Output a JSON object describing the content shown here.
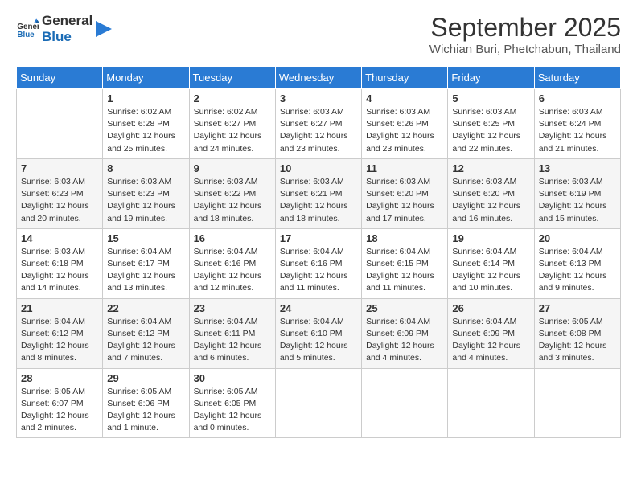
{
  "header": {
    "logo_line1": "General",
    "logo_line2": "Blue",
    "month": "September 2025",
    "location": "Wichian Buri, Phetchabun, Thailand"
  },
  "weekdays": [
    "Sunday",
    "Monday",
    "Tuesday",
    "Wednesday",
    "Thursday",
    "Friday",
    "Saturday"
  ],
  "weeks": [
    [
      {
        "day": "",
        "info": ""
      },
      {
        "day": "1",
        "info": "Sunrise: 6:02 AM\nSunset: 6:28 PM\nDaylight: 12 hours\nand 25 minutes."
      },
      {
        "day": "2",
        "info": "Sunrise: 6:02 AM\nSunset: 6:27 PM\nDaylight: 12 hours\nand 24 minutes."
      },
      {
        "day": "3",
        "info": "Sunrise: 6:03 AM\nSunset: 6:27 PM\nDaylight: 12 hours\nand 23 minutes."
      },
      {
        "day": "4",
        "info": "Sunrise: 6:03 AM\nSunset: 6:26 PM\nDaylight: 12 hours\nand 23 minutes."
      },
      {
        "day": "5",
        "info": "Sunrise: 6:03 AM\nSunset: 6:25 PM\nDaylight: 12 hours\nand 22 minutes."
      },
      {
        "day": "6",
        "info": "Sunrise: 6:03 AM\nSunset: 6:24 PM\nDaylight: 12 hours\nand 21 minutes."
      }
    ],
    [
      {
        "day": "7",
        "info": "Sunrise: 6:03 AM\nSunset: 6:23 PM\nDaylight: 12 hours\nand 20 minutes."
      },
      {
        "day": "8",
        "info": "Sunrise: 6:03 AM\nSunset: 6:23 PM\nDaylight: 12 hours\nand 19 minutes."
      },
      {
        "day": "9",
        "info": "Sunrise: 6:03 AM\nSunset: 6:22 PM\nDaylight: 12 hours\nand 18 minutes."
      },
      {
        "day": "10",
        "info": "Sunrise: 6:03 AM\nSunset: 6:21 PM\nDaylight: 12 hours\nand 18 minutes."
      },
      {
        "day": "11",
        "info": "Sunrise: 6:03 AM\nSunset: 6:20 PM\nDaylight: 12 hours\nand 17 minutes."
      },
      {
        "day": "12",
        "info": "Sunrise: 6:03 AM\nSunset: 6:20 PM\nDaylight: 12 hours\nand 16 minutes."
      },
      {
        "day": "13",
        "info": "Sunrise: 6:03 AM\nSunset: 6:19 PM\nDaylight: 12 hours\nand 15 minutes."
      }
    ],
    [
      {
        "day": "14",
        "info": "Sunrise: 6:03 AM\nSunset: 6:18 PM\nDaylight: 12 hours\nand 14 minutes."
      },
      {
        "day": "15",
        "info": "Sunrise: 6:04 AM\nSunset: 6:17 PM\nDaylight: 12 hours\nand 13 minutes."
      },
      {
        "day": "16",
        "info": "Sunrise: 6:04 AM\nSunset: 6:16 PM\nDaylight: 12 hours\nand 12 minutes."
      },
      {
        "day": "17",
        "info": "Sunrise: 6:04 AM\nSunset: 6:16 PM\nDaylight: 12 hours\nand 11 minutes."
      },
      {
        "day": "18",
        "info": "Sunrise: 6:04 AM\nSunset: 6:15 PM\nDaylight: 12 hours\nand 11 minutes."
      },
      {
        "day": "19",
        "info": "Sunrise: 6:04 AM\nSunset: 6:14 PM\nDaylight: 12 hours\nand 10 minutes."
      },
      {
        "day": "20",
        "info": "Sunrise: 6:04 AM\nSunset: 6:13 PM\nDaylight: 12 hours\nand 9 minutes."
      }
    ],
    [
      {
        "day": "21",
        "info": "Sunrise: 6:04 AM\nSunset: 6:12 PM\nDaylight: 12 hours\nand 8 minutes."
      },
      {
        "day": "22",
        "info": "Sunrise: 6:04 AM\nSunset: 6:12 PM\nDaylight: 12 hours\nand 7 minutes."
      },
      {
        "day": "23",
        "info": "Sunrise: 6:04 AM\nSunset: 6:11 PM\nDaylight: 12 hours\nand 6 minutes."
      },
      {
        "day": "24",
        "info": "Sunrise: 6:04 AM\nSunset: 6:10 PM\nDaylight: 12 hours\nand 5 minutes."
      },
      {
        "day": "25",
        "info": "Sunrise: 6:04 AM\nSunset: 6:09 PM\nDaylight: 12 hours\nand 4 minutes."
      },
      {
        "day": "26",
        "info": "Sunrise: 6:04 AM\nSunset: 6:09 PM\nDaylight: 12 hours\nand 4 minutes."
      },
      {
        "day": "27",
        "info": "Sunrise: 6:05 AM\nSunset: 6:08 PM\nDaylight: 12 hours\nand 3 minutes."
      }
    ],
    [
      {
        "day": "28",
        "info": "Sunrise: 6:05 AM\nSunset: 6:07 PM\nDaylight: 12 hours\nand 2 minutes."
      },
      {
        "day": "29",
        "info": "Sunrise: 6:05 AM\nSunset: 6:06 PM\nDaylight: 12 hours\nand 1 minute."
      },
      {
        "day": "30",
        "info": "Sunrise: 6:05 AM\nSunset: 6:05 PM\nDaylight: 12 hours\nand 0 minutes."
      },
      {
        "day": "",
        "info": ""
      },
      {
        "day": "",
        "info": ""
      },
      {
        "day": "",
        "info": ""
      },
      {
        "day": "",
        "info": ""
      }
    ]
  ]
}
